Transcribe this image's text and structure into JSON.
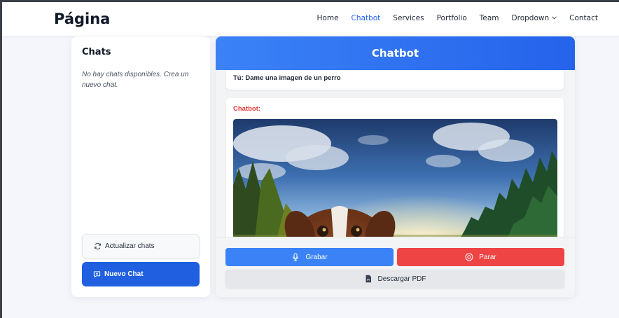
{
  "header": {
    "logo": "Página",
    "nav": [
      {
        "label": "Home"
      },
      {
        "label": "Chatbot",
        "active": true
      },
      {
        "label": "Services"
      },
      {
        "label": "Portfolio"
      },
      {
        "label": "Team"
      },
      {
        "label": "Dropdown",
        "has_dropdown": true
      },
      {
        "label": "Contact"
      }
    ]
  },
  "sidebar": {
    "title": "Chats",
    "empty_text": "No hay chats disponibles. Crea un nuevo chat.",
    "refresh_label": "Actualizar chats",
    "refresh_icon": "refresh-icon",
    "new_chat_label": "Nuevo Chat",
    "new_chat_icon": "chat-add-icon"
  },
  "chat": {
    "title": "Chatbot",
    "messages": [
      {
        "sender": "user",
        "text": "Tú: Dame una imagen de un perro"
      },
      {
        "sender": "bot",
        "label": "Chatbot:",
        "content": "image of a dog peeking over the bottom edge with blue sky, clouds and pine forest"
      }
    ]
  },
  "controls": {
    "record_label": "Grabar",
    "record_icon": "microphone-icon",
    "stop_label": "Parar",
    "stop_icon": "stop-circle-icon",
    "pdf_label": "Descargar PDF",
    "pdf_icon": "pdf-file-icon"
  },
  "colors": {
    "accent": "#2563eb",
    "record": "#3b82f6",
    "stop": "#ef4444",
    "bot_label": "#e53935"
  }
}
